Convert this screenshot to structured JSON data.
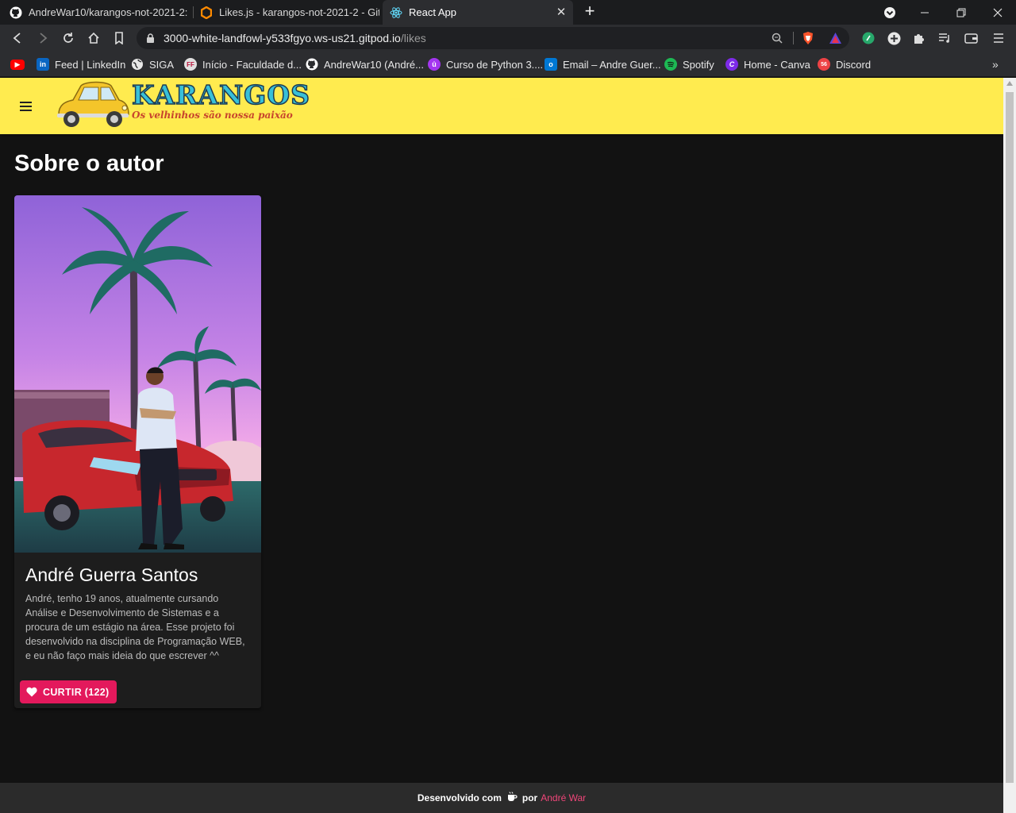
{
  "browser": {
    "tabs": [
      {
        "title": "AndreWar10/karangos-not-2021-2:",
        "icon": "github-icon"
      },
      {
        "title": "Likes.js - karangos-not-2021-2 - Gitpod",
        "icon": "gitpod-icon"
      },
      {
        "title": "React App",
        "icon": "react-icon",
        "active": true
      }
    ],
    "url_host": "3000-white-landfowl-y533fgyo.ws-us21.gitpod.io",
    "url_path": "/likes",
    "bookmarks": [
      {
        "label": "",
        "icon": "youtube-icon",
        "color": "#ff0000"
      },
      {
        "label": "Feed | LinkedIn",
        "icon": "linkedin-icon",
        "color": "#0a66c2"
      },
      {
        "label": "SIGA",
        "icon": "globe-icon",
        "color": "#ffffff"
      },
      {
        "label": "Início - Faculdade d...",
        "icon": "fatec-icon",
        "color": "#e0e0e0"
      },
      {
        "label": "AndreWar10 (André...",
        "icon": "github-icon",
        "color": "#ffffff"
      },
      {
        "label": "Curso de Python 3....",
        "icon": "udemy-icon",
        "color": "#a435f0"
      },
      {
        "label": "Email – Andre Guer...",
        "icon": "outlook-icon",
        "color": "#0078d4"
      },
      {
        "label": "Spotify",
        "icon": "spotify-icon",
        "color": "#1db954"
      },
      {
        "label": "Home - Canva",
        "icon": "canva-icon",
        "color": "#7d2ae8"
      },
      {
        "label": "Discord",
        "icon": "discord-icon",
        "color": "#ed4245",
        "badge": "56"
      }
    ]
  },
  "app": {
    "logo_title": "KARANGOS",
    "logo_tagline": "Os velhinhos são nossa paixão",
    "page_title": "Sobre o autor",
    "card": {
      "name": "André Guerra Santos",
      "description": "André, tenho 19 anos, atualmente cursando Análise e Desenvolvimento de Sistemas e a procura de um estágio na área. Esse projeto foi desenvolvido na disciplina de Programação WEB, e eu não faço mais ideia do que escrever ^^",
      "like_label": "CURTIR (122)"
    },
    "footer": {
      "prefix": "Desenvolvido com",
      "middle": "por",
      "author": "André War"
    },
    "colors": {
      "appbar": "#ffeb4f",
      "like_button": "#e3195c",
      "author_link": "#f0467a"
    }
  }
}
